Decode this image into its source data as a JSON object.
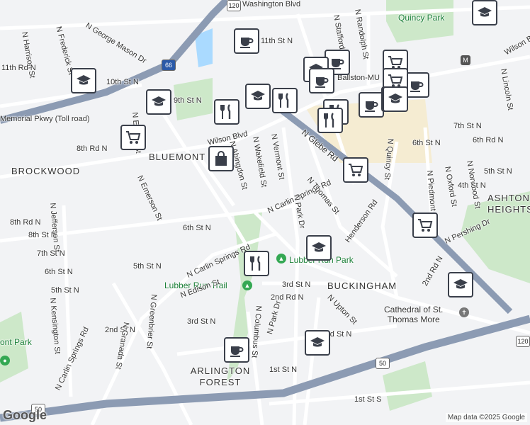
{
  "map": {
    "attribution": "Map data ©2025 Google",
    "logo": "Google",
    "colors": {
      "background": "#f2f3f5",
      "road": "#ffffff",
      "highway": "#8c9bb3",
      "park": "#cde8c9",
      "water": "#aadaff",
      "commercial": "#f5ecd2"
    }
  },
  "neighborhoods": [
    "BLUEMONT",
    "BROCKWOOD",
    "BUCKINGHAM",
    "ARLINGTON\nFOREST",
    "ASHTON\nHEIGHTS"
  ],
  "streets": [
    "Washington Blvd",
    "N George Mason Dr",
    "N Harrison St",
    "N Frederick St",
    "11th Rd N",
    "10th St N",
    "9th St N",
    "8th Rd N",
    "Wilson Blvd",
    "N Edison St",
    "Wilson Blvd",
    "11th St N",
    "N Stafford St",
    "N Randolph St",
    "Quincy Park",
    "Ballston-MU",
    "Wilson Blvd",
    "N Lincoln St",
    "7th St N",
    "6th Rd N",
    "6th St N",
    "5th St N",
    "N Norwood St",
    "N Oxford St",
    "N Piedmont St",
    "4th St N",
    "N Quincy St",
    "N Glebe Rd",
    "N Vermont St",
    "N Wakefield St",
    "N Abingdon St",
    "N Emerson St",
    "N Carlin Springs Rd",
    "N Thomas St",
    "Henderson Rd",
    "N Park Dr",
    "6th St N",
    "8th Rd N",
    "8th St N",
    "7th St N",
    "6th St N",
    "5th St N",
    "N Jefferson St",
    "5th St N",
    "N Carlin Springs Rd",
    "Lubber Run Park",
    "Lubber Run Trail",
    "3rd St N",
    "2nd Rd N",
    "N Upton St",
    "N Edison St",
    "3rd St N",
    "2nd St N",
    "N Greenbrier St",
    "N Granada St",
    "N Columbus St",
    "N Park Dr",
    "1st St N",
    "N Kensington St",
    "N Carlin Springs Rd",
    "1st St S",
    "N Pershing Dr",
    "2nd Rd N",
    "Cathedral of St.\nThomas More",
    "3rd St N",
    "N Oakland St",
    "Memorial Pkwy (Toll road)"
  ],
  "parks": [
    "Lubber Run Park",
    "Lubber Run Trail",
    "Quincy Park",
    "ont Park"
  ],
  "landmarks": {
    "cathedral": "Cathedral of St.\nThomas More",
    "metro": "Ballston-MU"
  },
  "shields": [
    "120",
    "66",
    "50",
    "50",
    "120"
  ],
  "markers": [
    {
      "icon": "coffee-icon"
    },
    {
      "icon": "school-icon"
    },
    {
      "icon": "school-icon"
    },
    {
      "icon": "shopping-cart-icon"
    },
    {
      "icon": "school-icon"
    },
    {
      "icon": "restaurant-icon"
    },
    {
      "icon": "shopping-bag-icon"
    },
    {
      "icon": "coffee-icon"
    },
    {
      "icon": "restaurant-icon"
    },
    {
      "icon": "school-icon"
    },
    {
      "icon": "shopping-cart-icon"
    },
    {
      "icon": "coffee-icon"
    },
    {
      "icon": "coffee-icon"
    },
    {
      "icon": "restaurant-icon"
    },
    {
      "icon": "shopping-cart-icon"
    },
    {
      "icon": "shopping-cart-icon"
    },
    {
      "icon": "school-icon"
    },
    {
      "icon": "school-icon"
    },
    {
      "icon": "restaurant-icon"
    },
    {
      "icon": "school-icon"
    },
    {
      "icon": "coffee-icon"
    },
    {
      "icon": "school-icon"
    },
    {
      "icon": "shopping-cart-icon"
    },
    {
      "icon": "coffee-icon"
    },
    {
      "icon": "coffee-icon"
    },
    {
      "icon": "restaurant-icon"
    },
    {
      "icon": "school-icon"
    }
  ]
}
